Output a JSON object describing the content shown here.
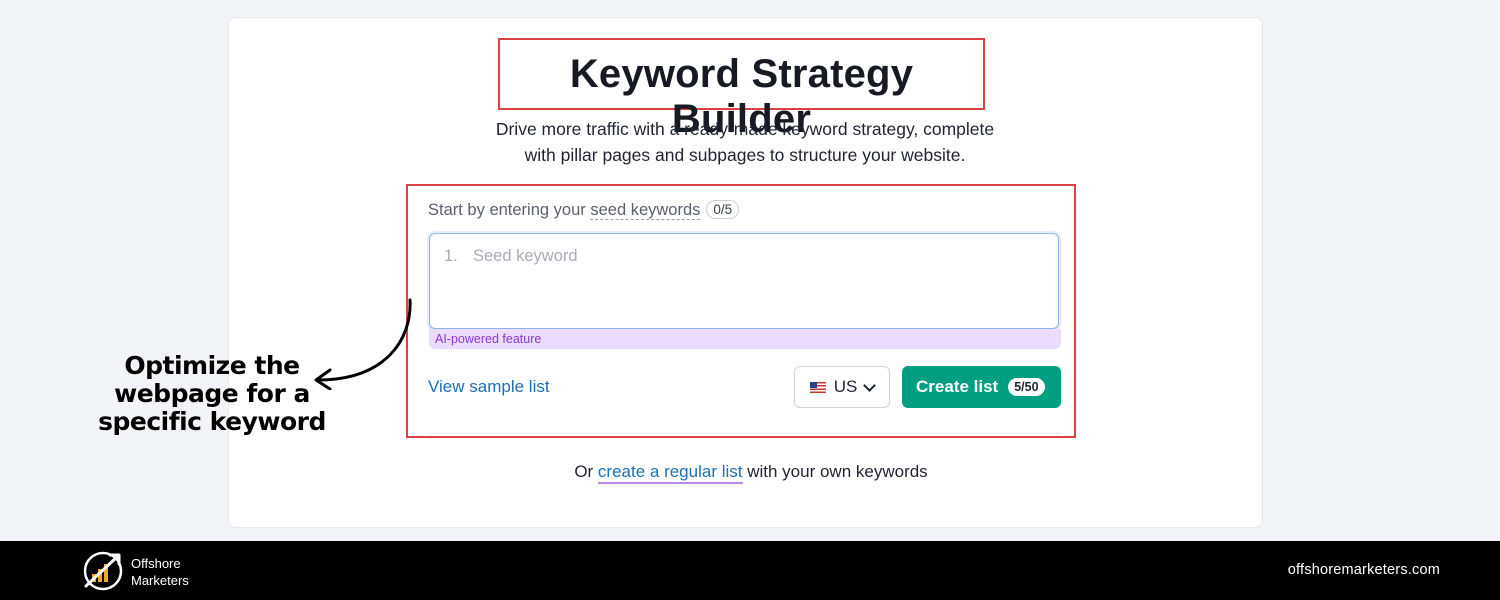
{
  "page": {
    "title": "Keyword Strategy Builder",
    "subtitle_line1": "Drive more traffic with a ready-made keyword strategy, complete",
    "subtitle_line2": "with pillar pages and subpages to structure your website."
  },
  "form": {
    "prompt_prefix": "Start by entering your ",
    "prompt_link": "seed keywords",
    "counter": "0/5",
    "input_number": "1.",
    "input_placeholder": "Seed keyword",
    "ai_label": "AI-powered feature",
    "sample_link": "View sample list",
    "country": "US",
    "country_flag_icon": "us-flag-icon",
    "create_label": "Create list",
    "create_badge": "5/50"
  },
  "footer": {
    "prefix": "Or ",
    "link": "create a regular list",
    "suffix": " with your own keywords"
  },
  "annotation": {
    "line1": "Optimize the",
    "line2": "webpage for a",
    "line3": "specific keyword"
  },
  "brand": {
    "name_line1": "Offshore",
    "name_line2": "Marketers",
    "url": "offshoremarketers.com",
    "logo_icon": "offshore-marketers-logo-icon"
  },
  "colors": {
    "highlight_border": "#d94343",
    "primary_button": "#009f81",
    "link": "#1e6fb8",
    "ai_badge_bg": "#ecdcfb",
    "bottom_bar": "#000000"
  }
}
